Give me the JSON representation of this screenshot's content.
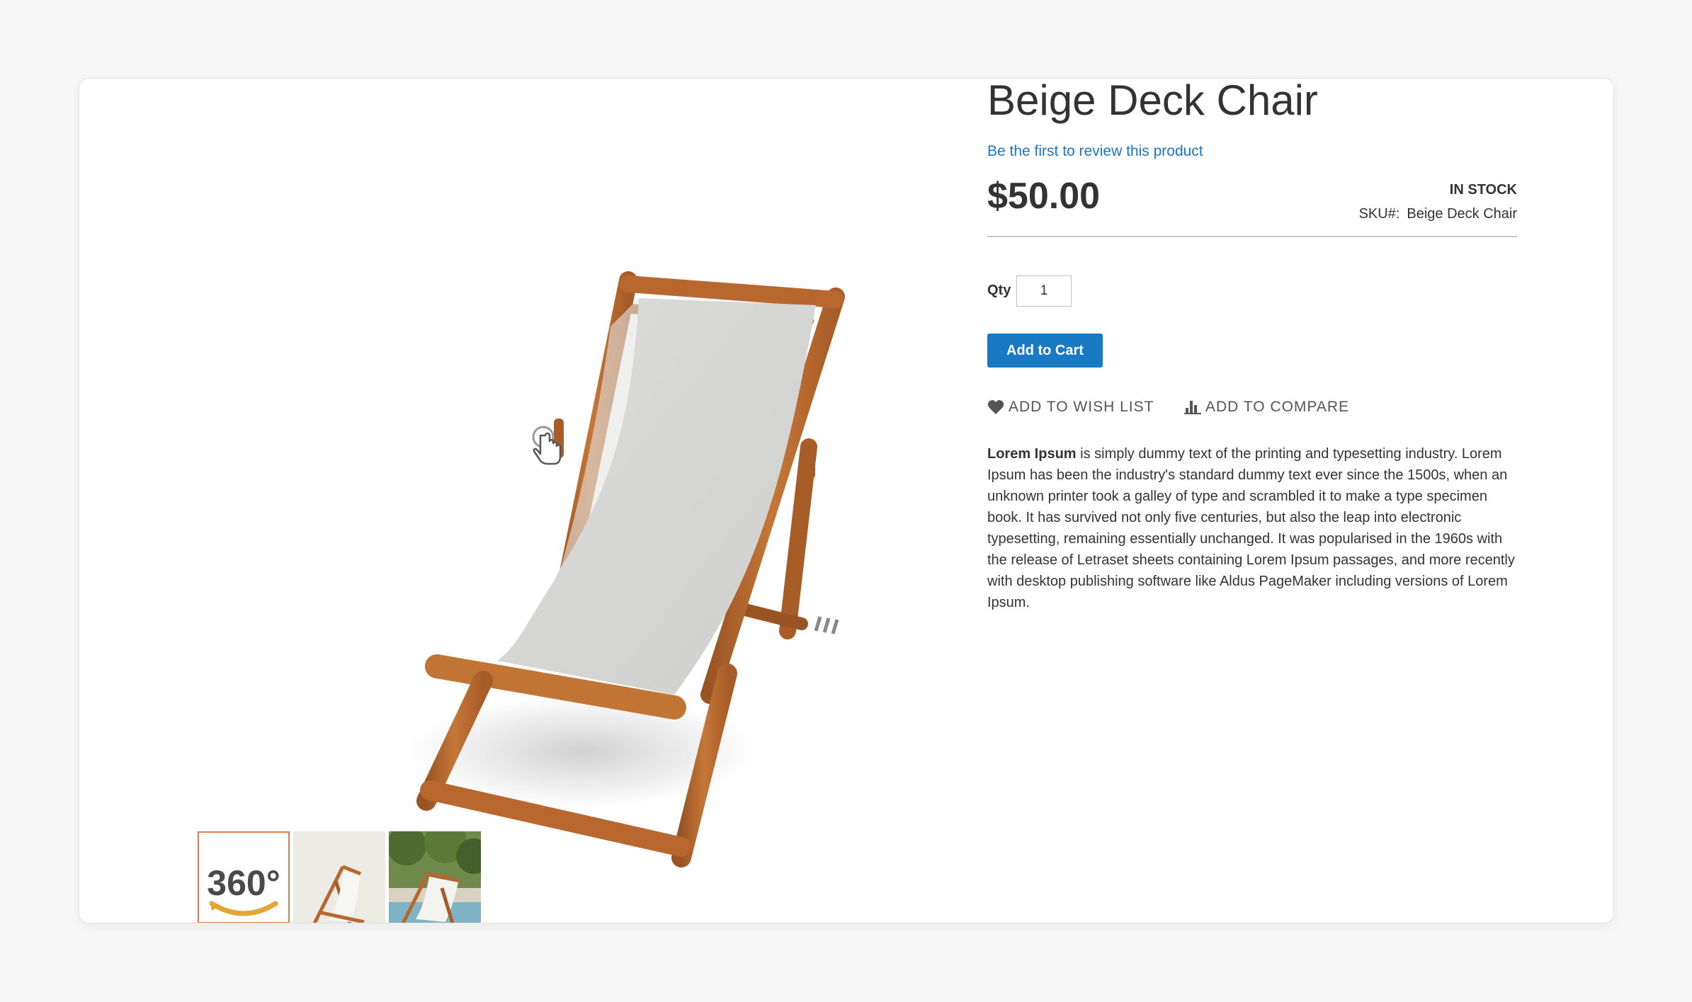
{
  "product": {
    "title": "Beige Deck Chair",
    "review_link": "Be the first to review this product",
    "price": "$50.00",
    "stock_status": "IN STOCK",
    "sku_label": "SKU#:",
    "sku_value": "Beige Deck Chair"
  },
  "cart": {
    "qty_label": "Qty",
    "qty_value": "1",
    "add_to_cart_label": "Add to Cart"
  },
  "actions": {
    "wish_list_label": "Add to Wish List",
    "compare_label": "Add to Compare"
  },
  "description": {
    "lead": "Lorem Ipsum",
    "body": " is simply dummy text of the printing and typesetting industry. Lorem Ipsum has been the industry's standard dummy text ever since the 1500s, when an unknown printer took a galley of type and scrambled it to make a type specimen book. It has survived not only five centuries, but also the leap into electronic typesetting, remaining essentially unchanged. It was popularised in the 1960s with the release of Letraset sheets containing Lorem Ipsum passages, and more recently with desktop publishing software like Aldus PageMaker including versions of Lorem Ipsum."
  },
  "gallery": {
    "thumb_360_label": "360°"
  },
  "colors": {
    "accent_blue": "#1979c3",
    "active_thumb_border": "#e27c48",
    "wood": "#b8672e",
    "canvas": "#d6d6d4"
  },
  "icons": {
    "wish_list": "heart-icon",
    "compare": "bar-chart-icon",
    "viewer_cursor": "hand-pointer-icon"
  }
}
